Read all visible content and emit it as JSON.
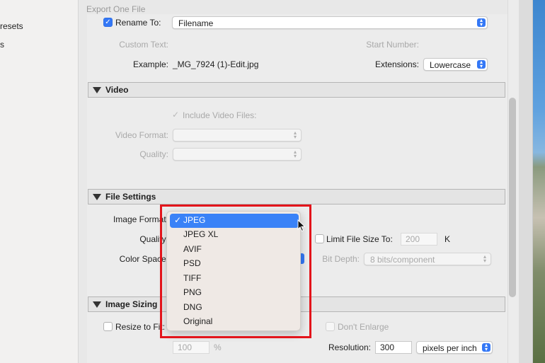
{
  "window": {
    "title": "Export One File"
  },
  "left_panel": {
    "items": [
      "resets",
      "s"
    ]
  },
  "file_naming": {
    "rename_to_label": "Rename To:",
    "rename_to_checked": true,
    "rename_to_value": "Filename",
    "custom_text_label": "Custom Text:",
    "start_number_label": "Start Number:",
    "example_label": "Example:",
    "example_value": "_MG_7924 (1)-Edit.jpg",
    "extensions_label": "Extensions:",
    "extensions_value": "Lowercase"
  },
  "video": {
    "title": "Video",
    "include_label": "Include Video Files:",
    "format_label": "Video Format:",
    "quality_label": "Quality:"
  },
  "file_settings": {
    "title": "File Settings",
    "image_format_label": "Image Format:",
    "quality_label": "Quality:",
    "color_space_label": "Color Space:",
    "limit_label": "Limit File Size To:",
    "limit_value": "200",
    "limit_unit": "K",
    "bit_depth_label": "Bit Depth:",
    "bit_depth_value": "8 bits/component"
  },
  "format_menu": {
    "selected_index": 0,
    "items": [
      "JPEG",
      "JPEG XL",
      "AVIF",
      "PSD",
      "TIFF",
      "PNG",
      "DNG",
      "Original"
    ]
  },
  "image_sizing": {
    "title": "Image Sizing",
    "resize_label": "Resize to Fit:",
    "dont_enlarge_label": "Don't Enlarge",
    "percent_value": "100",
    "percent_unit": "%",
    "resolution_label": "Resolution:",
    "resolution_value": "300",
    "resolution_unit": "pixels per inch"
  },
  "colors": {
    "accent": "#3478f6",
    "highlight": "#e3141b"
  }
}
